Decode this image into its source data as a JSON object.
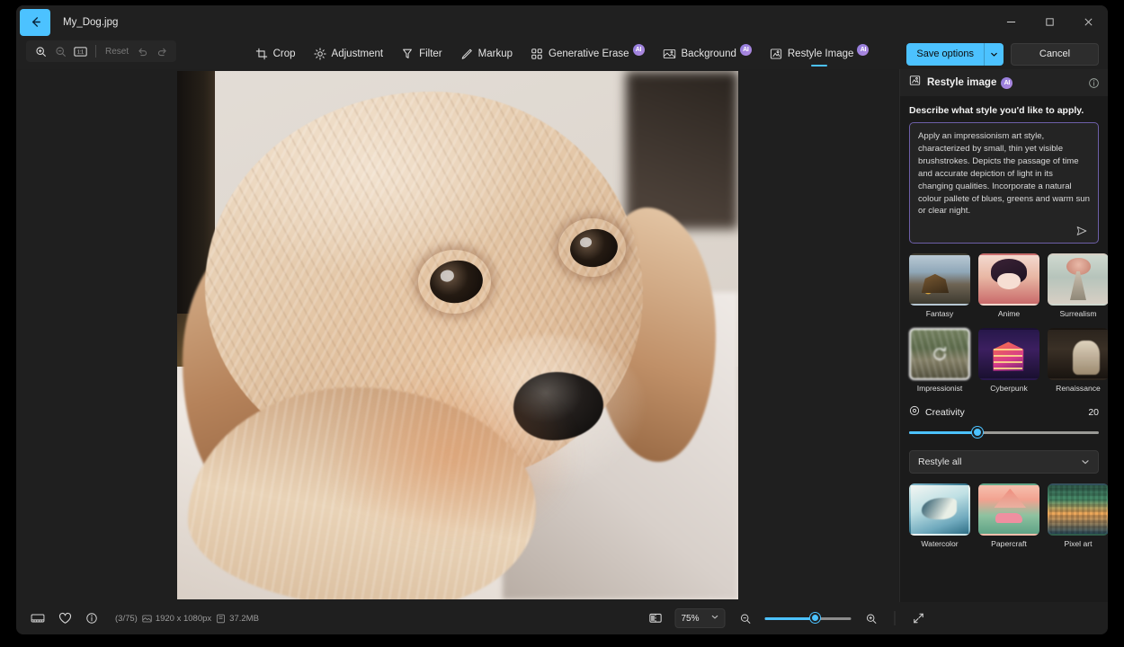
{
  "window": {
    "file_name": "My_Dog.jpg",
    "back_icon": "back-arrow-icon",
    "minimize": "—",
    "maximize": "▢",
    "close": "✕"
  },
  "zoom_tools": {
    "zoom_in": "zoom-in-icon",
    "zoom_out": "zoom-out-icon",
    "fit": "fit-to-window-icon",
    "reset_label": "Reset",
    "undo": "undo-icon",
    "redo": "redo-icon"
  },
  "toolbar": {
    "items": [
      {
        "label": "Crop",
        "icon": "crop-icon",
        "ai": false,
        "active": false
      },
      {
        "label": "Adjustment",
        "icon": "brightness-icon",
        "ai": false,
        "active": false
      },
      {
        "label": "Filter",
        "icon": "filter-icon",
        "ai": false,
        "active": false
      },
      {
        "label": "Markup",
        "icon": "pen-icon",
        "ai": false,
        "active": false
      },
      {
        "label": "Generative Erase",
        "icon": "erase-grid-icon",
        "ai": true,
        "active": false
      },
      {
        "label": "Background",
        "icon": "background-icon",
        "ai": true,
        "active": false
      },
      {
        "label": "Restyle Image",
        "icon": "restyle-icon",
        "ai": true,
        "active": true
      }
    ],
    "ai_badge_text": "AI",
    "save_label": "Save options",
    "save_chevron": "chevron-down-icon",
    "cancel_label": "Cancel",
    "accent_color": "#4cc2ff",
    "ai_badge_color": "#a98ae0"
  },
  "panel": {
    "title": "Restyle image",
    "title_icon": "restyle-icon",
    "ai_badge_text": "AI",
    "info_icon": "info-circle-icon",
    "describe_label": "Describe what style you'd like to apply.",
    "prompt_value": "Apply an impressionism art style, characterized by small, thin yet visible brushstrokes. Depicts the passage of time and accurate depiction of light in its changing qualities. Incorporate a natural colour pallete of blues, greens and warm sun or clear night.",
    "prompt_placeholder": "Describe what style you'd like to apply.",
    "send_icon": "send-paper-plane-icon",
    "prompt_border_color": "#6d5fa8",
    "styles_top": [
      {
        "label": "Fantasy",
        "art": "t-fantasy",
        "selected": false,
        "loading": false
      },
      {
        "label": "Anime",
        "art": "t-anime",
        "selected": false,
        "loading": false
      },
      {
        "label": "Surrealism",
        "art": "t-surreal",
        "selected": false,
        "loading": false
      }
    ],
    "styles_mid": [
      {
        "label": "Impressionist",
        "art": "t-impress",
        "selected": true,
        "loading": true
      },
      {
        "label": "Cyberpunk",
        "art": "t-cyber",
        "selected": false,
        "loading": false
      },
      {
        "label": "Renaissance",
        "art": "t-renais",
        "selected": false,
        "loading": false
      }
    ],
    "styles_bottom": [
      {
        "label": "Watercolor",
        "art": "t-water",
        "selected": false,
        "loading": false
      },
      {
        "label": "Papercraft",
        "art": "t-paper",
        "selected": false,
        "loading": false
      },
      {
        "label": "Pixel art",
        "art": "t-pixel",
        "selected": false,
        "loading": false
      }
    ],
    "creativity_label": "Creativity",
    "creativity_icon": "creativity-icon",
    "creativity_value": "20",
    "creativity_percent": 36,
    "restyle_scope_value": "Restyle all",
    "restyle_scope_chevron": "chevron-down-icon",
    "loading_icon": "refresh-spinner-icon"
  },
  "statusbar": {
    "filmstrip_icon": "filmstrip-icon",
    "favorite_icon": "heart-icon",
    "info_icon": "info-circle-icon",
    "counter": "(3/75)",
    "dimensions_icon": "image-size-icon",
    "dimensions": "1920 x 1080px",
    "filesize_icon": "file-size-icon",
    "filesize": "37.2MB",
    "compare_icon": "compare-icon",
    "zoom_value": "75%",
    "zoom_chevron": "chevron-down-icon",
    "zoom_out_icon": "zoom-out-icon",
    "zoom_in_icon": "zoom-in-icon",
    "zoom_percent": 58,
    "fullscreen_icon": "fullscreen-icon"
  },
  "canvas": {
    "image_alt": "impressionist-styled dog portrait"
  }
}
